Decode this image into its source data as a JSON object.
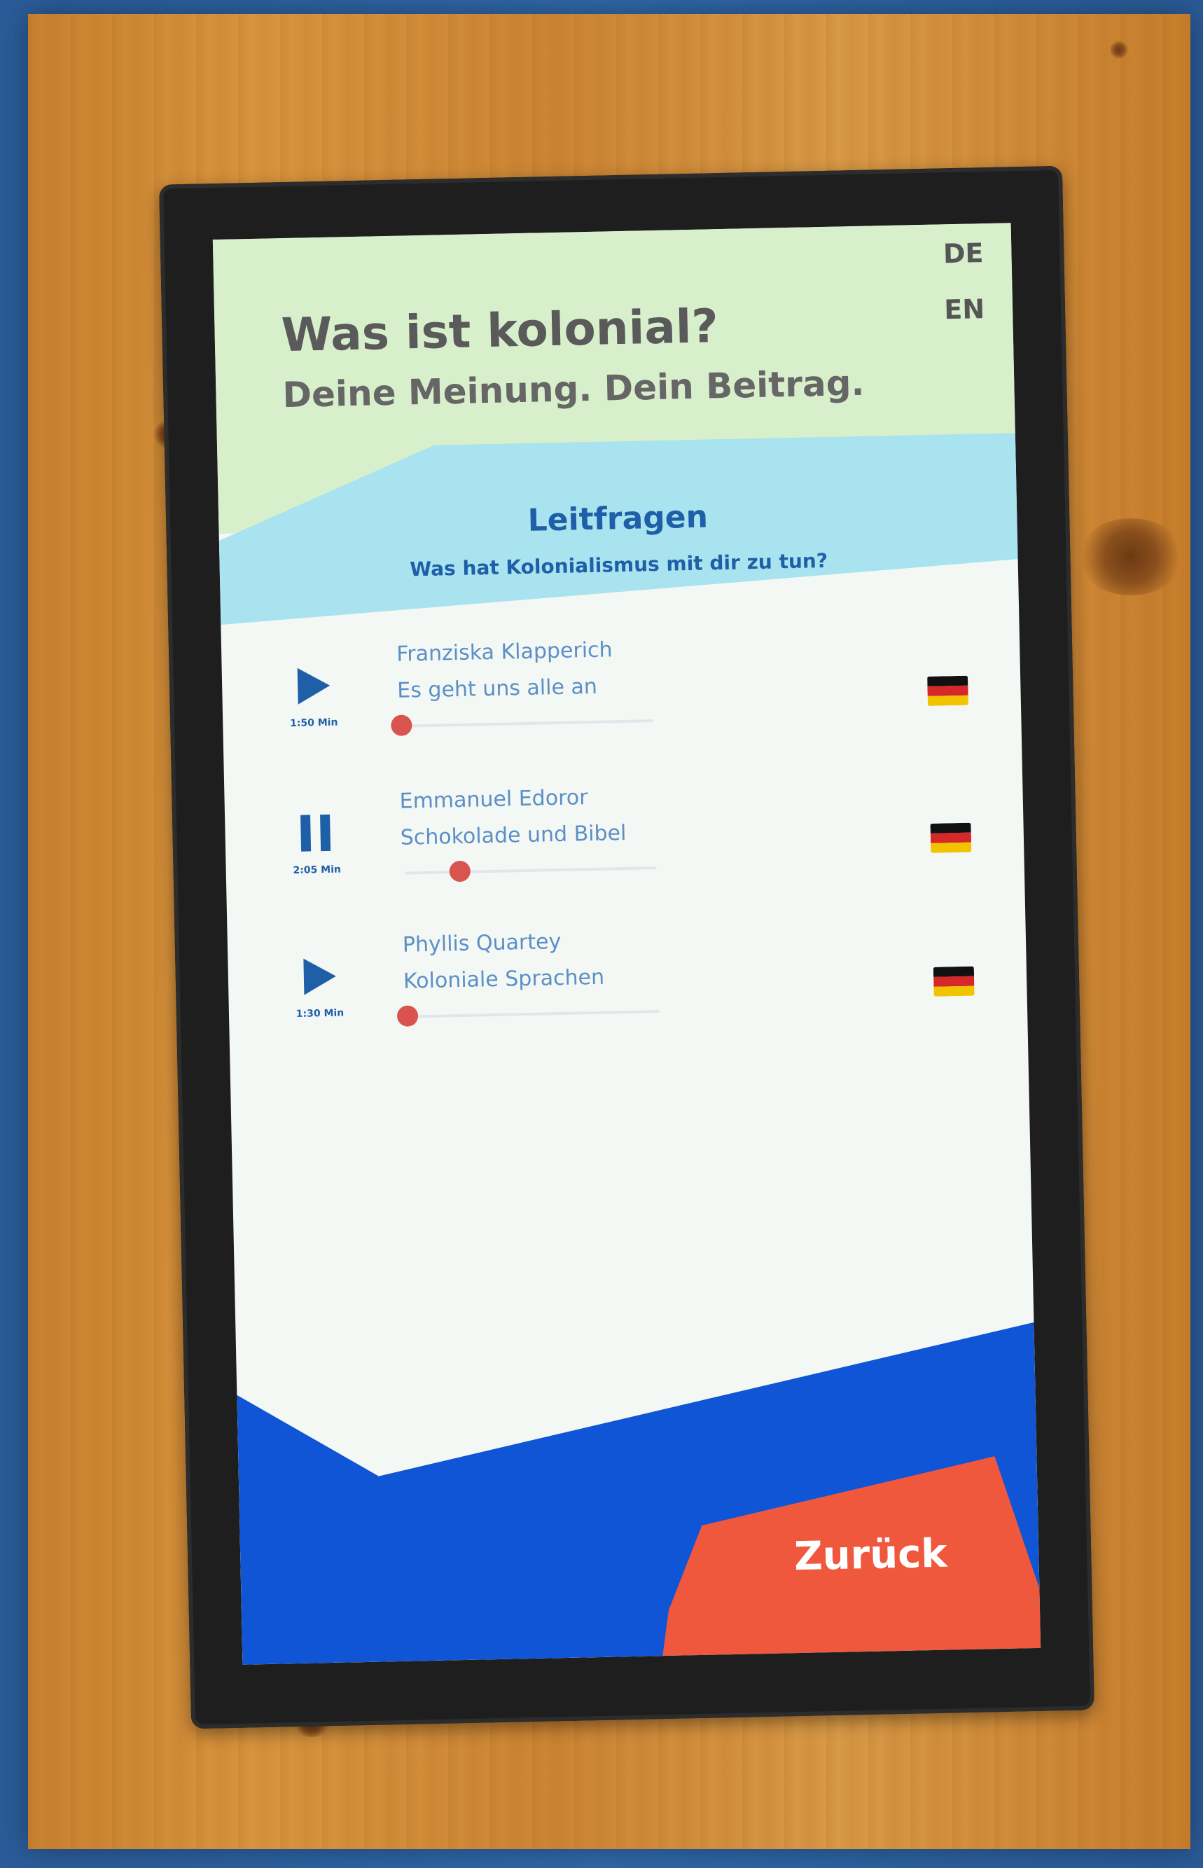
{
  "colors": {
    "header_bg": "#d7efcb",
    "lead_band": "#a8e3ef",
    "accent_blue": "#1f5fa8",
    "bottom_blue": "#0f55d6",
    "back_red": "#f0583e",
    "slider_knob": "#d9534f"
  },
  "header": {
    "title": "Was ist kolonial?",
    "subtitle": "Deine Meinung. Dein Beitrag."
  },
  "language": {
    "de_label": "DE",
    "en_label": "EN"
  },
  "lead": {
    "title": "Leitfragen",
    "question": "Was hat Kolonialismus mit dir zu tun?"
  },
  "tracks": [
    {
      "author": "Franziska Klapperich",
      "title": "Es geht uns alle an",
      "duration": "1:50 Min",
      "state_icon": "play-icon",
      "progress": 0.0
    },
    {
      "author": "Emmanuel Edoror",
      "title": "Schokolade und Bibel",
      "duration": "2:05 Min",
      "state_icon": "pause-icon",
      "progress": 0.22
    },
    {
      "author": "Phyllis Quartey",
      "title": "Koloniale Sprachen",
      "duration": "1:30 Min",
      "state_icon": "play-icon",
      "progress": 0.0
    }
  ],
  "footer": {
    "back_label": "Zurück"
  }
}
